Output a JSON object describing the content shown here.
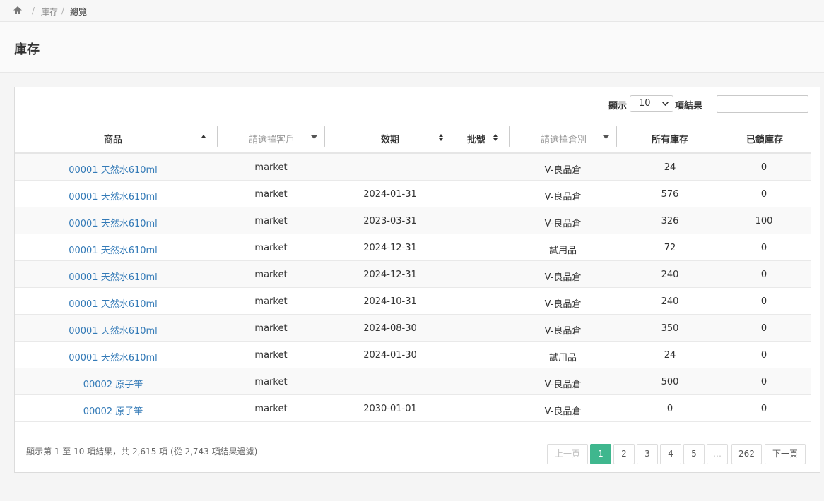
{
  "breadcrumb": {
    "home_icon": "home-icon",
    "items": [
      "庫存",
      "總覽"
    ]
  },
  "page": {
    "title": "庫存"
  },
  "controls": {
    "show_label": "顯示",
    "page_length": "10",
    "results_label": "項結果",
    "search_value": ""
  },
  "table": {
    "columns": {
      "product": "商品",
      "customer_placeholder": "請選擇客戶",
      "expiry": "效期",
      "batch": "批號",
      "warehouse_placeholder": "請選擇倉別",
      "total_stock": "所有庫存",
      "locked_stock": "已鎖庫存"
    },
    "rows": [
      {
        "product": "00001 天然水610ml",
        "customer": "market",
        "expiry": "",
        "warehouse": "V-良品倉",
        "total": "24",
        "locked": "0"
      },
      {
        "product": "00001 天然水610ml",
        "customer": "market",
        "expiry": "2024-01-31",
        "warehouse": "V-良品倉",
        "total": "576",
        "locked": "0"
      },
      {
        "product": "00001 天然水610ml",
        "customer": "market",
        "expiry": "2023-03-31",
        "warehouse": "V-良品倉",
        "total": "326",
        "locked": "100"
      },
      {
        "product": "00001 天然水610ml",
        "customer": "market",
        "expiry": "2024-12-31",
        "warehouse": "試用品",
        "total": "72",
        "locked": "0"
      },
      {
        "product": "00001 天然水610ml",
        "customer": "market",
        "expiry": "2024-12-31",
        "warehouse": "V-良品倉",
        "total": "240",
        "locked": "0"
      },
      {
        "product": "00001 天然水610ml",
        "customer": "market",
        "expiry": "2024-10-31",
        "warehouse": "V-良品倉",
        "total": "240",
        "locked": "0"
      },
      {
        "product": "00001 天然水610ml",
        "customer": "market",
        "expiry": "2024-08-30",
        "warehouse": "V-良品倉",
        "total": "350",
        "locked": "0"
      },
      {
        "product": "00001 天然水610ml",
        "customer": "market",
        "expiry": "2024-01-30",
        "warehouse": "試用品",
        "total": "24",
        "locked": "0"
      },
      {
        "product": "00002 原子筆",
        "customer": "market",
        "expiry": "",
        "warehouse": "V-良品倉",
        "total": "500",
        "locked": "0"
      },
      {
        "product": "00002 原子筆",
        "customer": "market",
        "expiry": "2030-01-01",
        "warehouse": "V-良品倉",
        "total": "0",
        "locked": "0"
      }
    ]
  },
  "footer": {
    "info": "顯示第 1 至 10 項結果，共 2,615 項 (從 2,743 項結果過濾)",
    "pagination": {
      "prev": "上一頁",
      "pages": [
        "1",
        "2",
        "3",
        "4",
        "5",
        "…",
        "262"
      ],
      "current": "1",
      "next": "下一頁"
    }
  },
  "colors": {
    "link": "#337ab7",
    "active_page": "#3fb78e"
  }
}
